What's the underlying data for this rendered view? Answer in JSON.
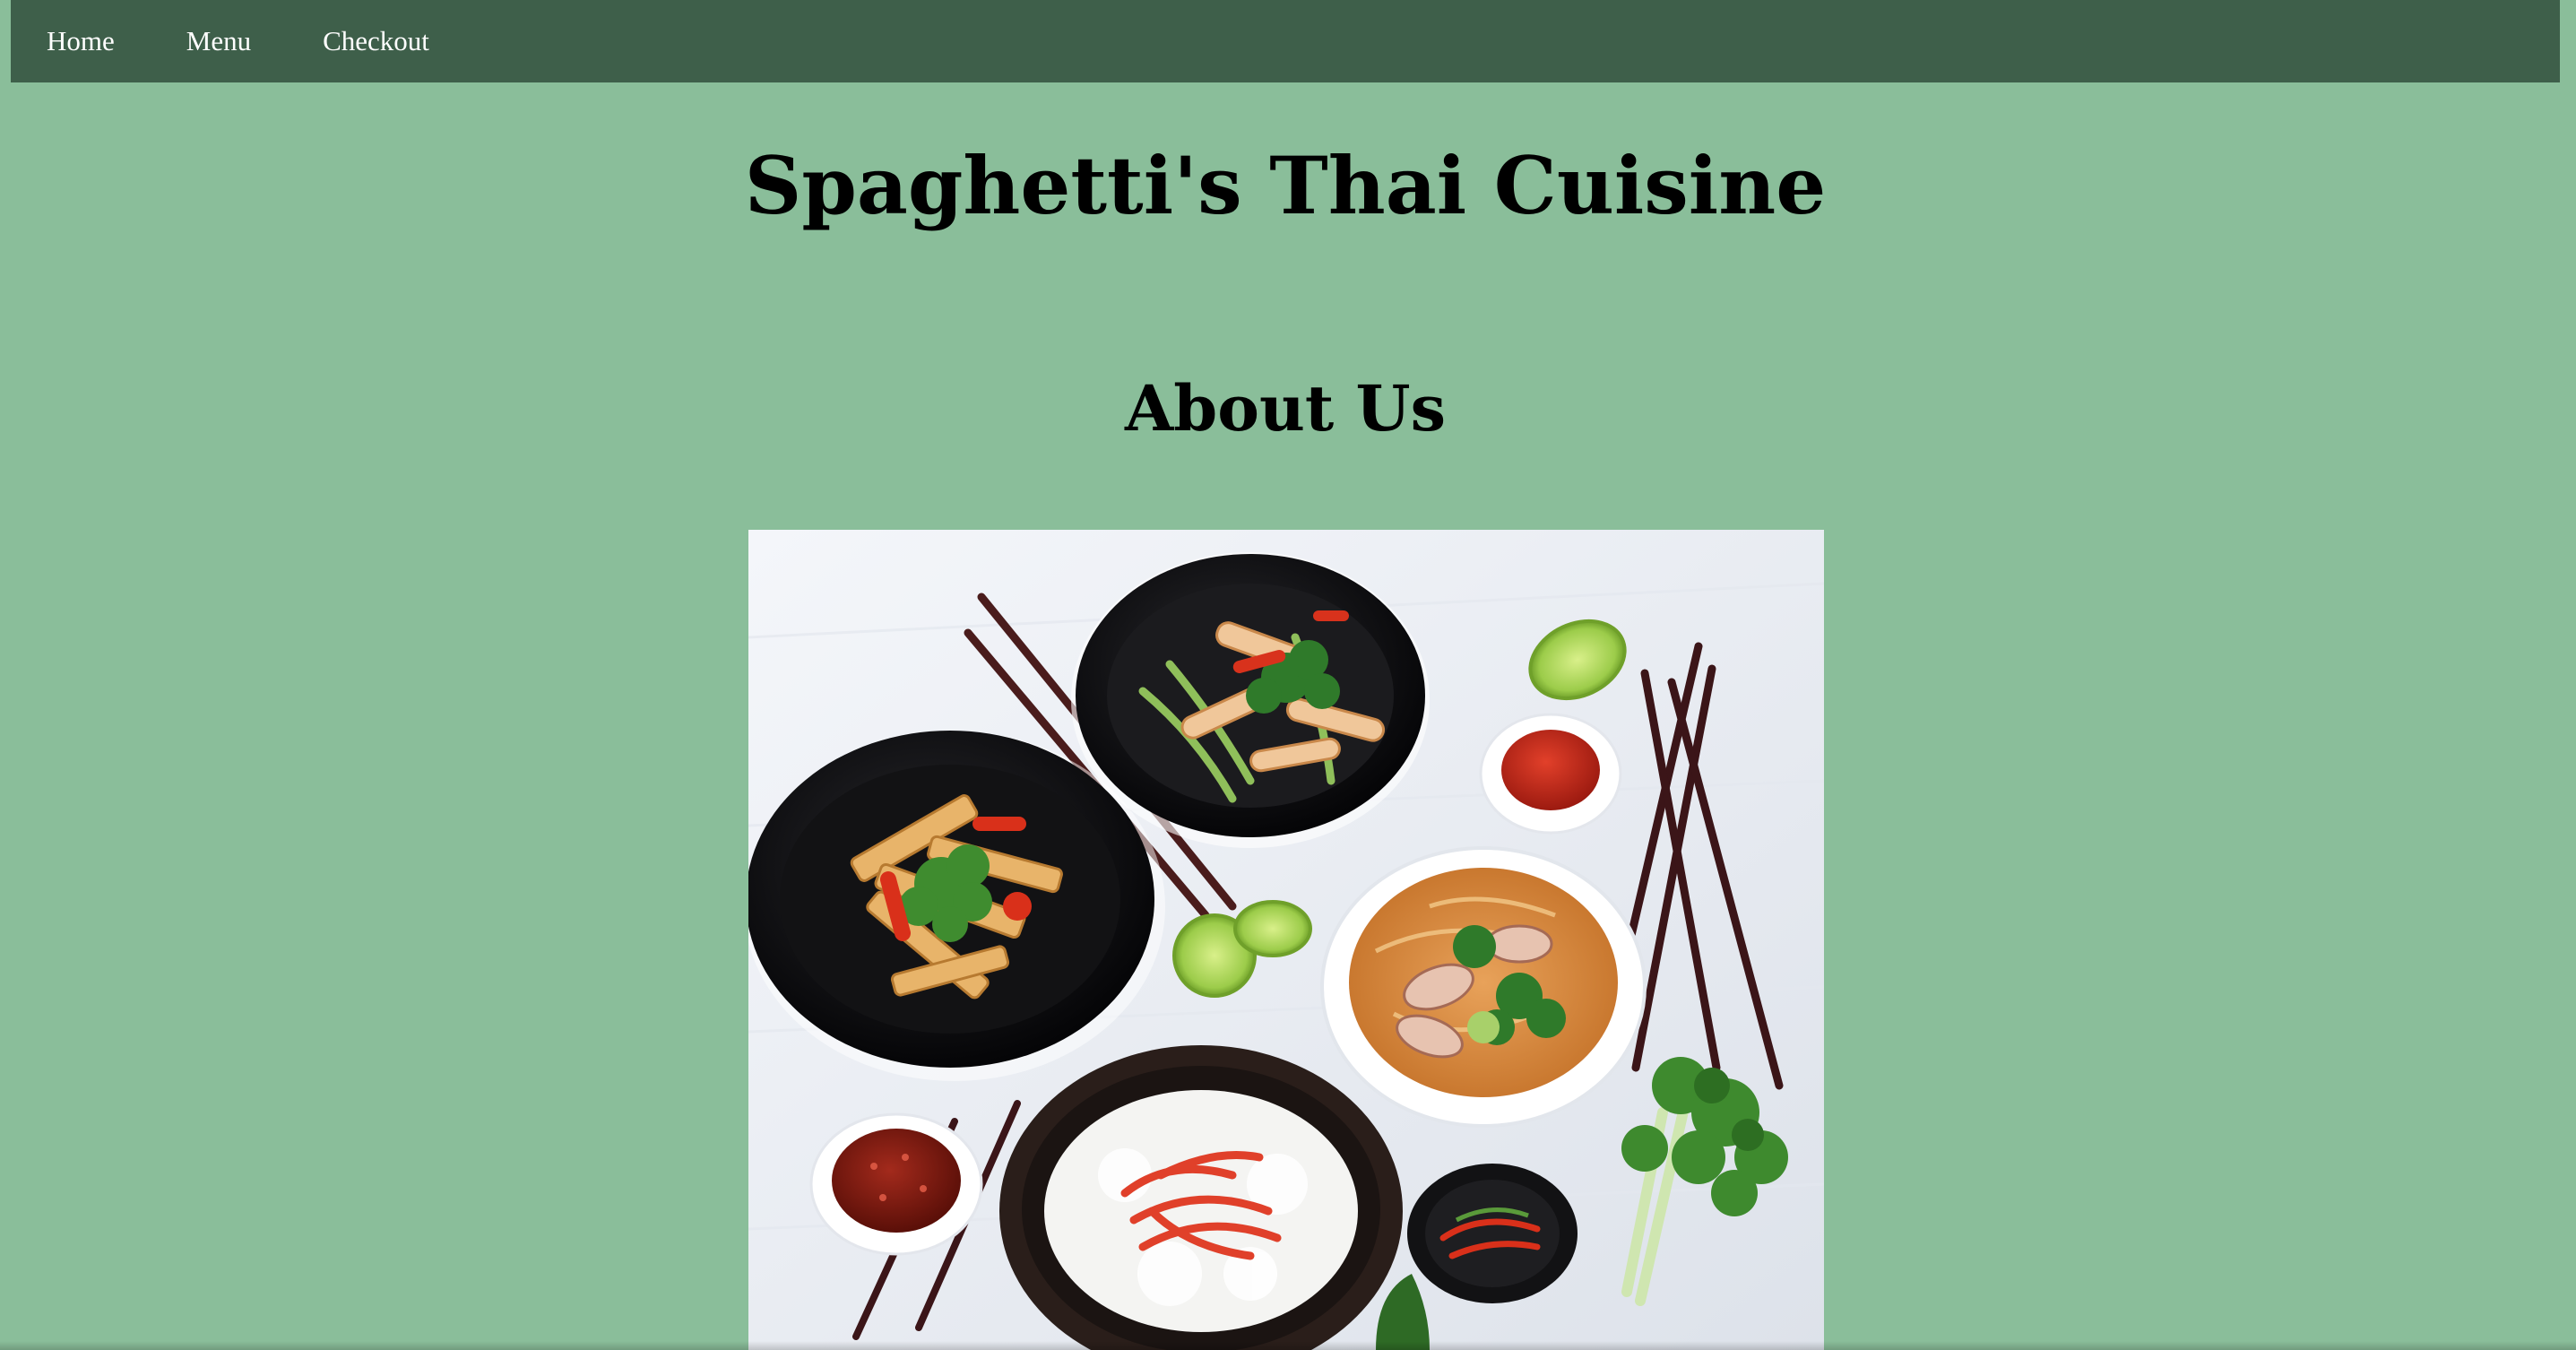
{
  "nav": {
    "items": [
      {
        "label": "Home"
      },
      {
        "label": "Menu"
      },
      {
        "label": "Checkout"
      }
    ]
  },
  "header": {
    "title": "Spaghetti's Thai Cuisine"
  },
  "about": {
    "heading": "About Us",
    "image_icon": "thai-dishes-photo"
  },
  "colors": {
    "page_background": "#8abe9a",
    "navbar_background": "#3e5f4a",
    "nav_text": "#ffffff",
    "heading_text": "#000000"
  }
}
